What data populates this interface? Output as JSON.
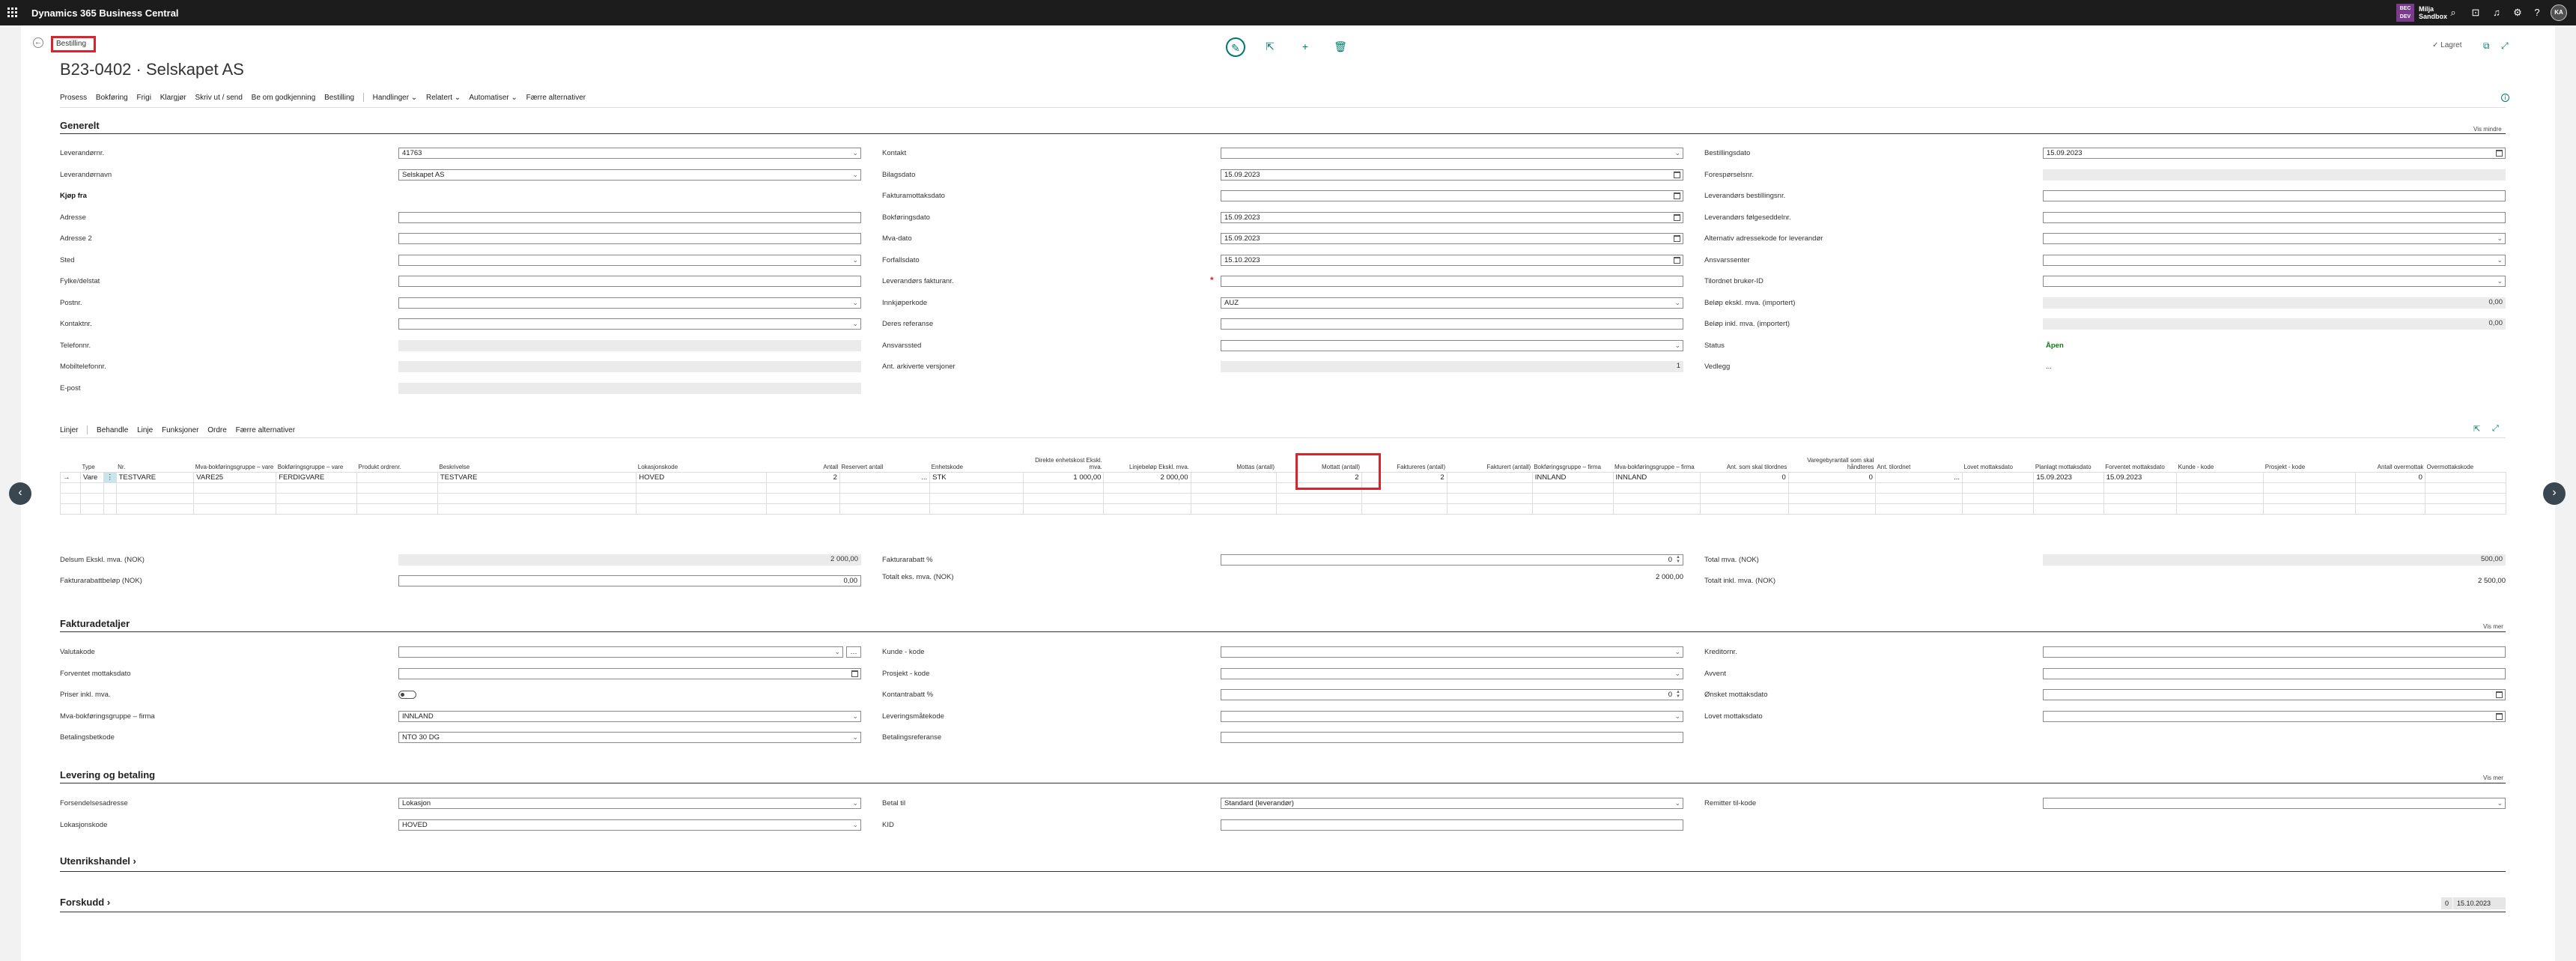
{
  "app": {
    "name": "Dynamics 365 Business Central",
    "company_initials": "BEC\nDEV",
    "company_line1": "Milja",
    "company_line2": "Sandbox",
    "avatar": "KA"
  },
  "header": {
    "breadcrumb": "Bestilling",
    "title": "B23-0402 · Selskapet AS",
    "saved": "✓ Lagret"
  },
  "actions": [
    "Prosess",
    "Bokføring",
    "Frigi",
    "Klargjør",
    "Skriv ut / send",
    "Be om godkjenning",
    "Bestilling"
  ],
  "actions2": [
    "Handlinger ⌄",
    "Relatert ⌄",
    "Automatiser ⌄",
    "Færre alternativer"
  ],
  "general": {
    "heading": "Generelt",
    "show_less": "Vis mindre",
    "col1": [
      {
        "label": "Leverandørnr.",
        "value": "41763",
        "type": "dd"
      },
      {
        "label": "Leverandørnavn",
        "value": "Selskapet AS",
        "type": "dd"
      },
      {
        "label": "Kjøp fra",
        "value": "",
        "type": "heading"
      },
      {
        "label": "Adresse",
        "value": "",
        "type": "text"
      },
      {
        "label": "Adresse 2",
        "value": "",
        "type": "text"
      },
      {
        "label": "Sted",
        "value": "",
        "type": "dd"
      },
      {
        "label": "Fylke/delstat",
        "value": "",
        "type": "text"
      },
      {
        "label": "Postnr.",
        "value": "",
        "type": "dd"
      },
      {
        "label": "Kontaktnr.",
        "value": "",
        "type": "dd"
      },
      {
        "label": "Telefonnr.",
        "value": "",
        "type": "ro"
      },
      {
        "label": "Mobiltelefonnr.",
        "value": "",
        "type": "ro"
      },
      {
        "label": "E-post",
        "value": "",
        "type": "ro"
      }
    ],
    "col2": [
      {
        "label": "Kontakt",
        "value": "",
        "type": "dd"
      },
      {
        "label": "Bilagsdato",
        "value": "15.09.2023",
        "type": "date"
      },
      {
        "label": "Fakturamottaksdato",
        "value": "",
        "type": "date"
      },
      {
        "label": "Bokføringsdato",
        "value": "15.09.2023",
        "type": "date"
      },
      {
        "label": "Mva-dato",
        "value": "15.09.2023",
        "type": "date"
      },
      {
        "label": "Forfallsdato",
        "value": "15.10.2023",
        "type": "date"
      },
      {
        "label": "Leverandørs fakturanr.",
        "value": "",
        "type": "req"
      },
      {
        "label": "Innkjøperkode",
        "value": "AUZ",
        "type": "dd"
      },
      {
        "label": "Deres referanse",
        "value": "",
        "type": "text"
      },
      {
        "label": "Ansvarssted",
        "value": "",
        "type": "dd"
      },
      {
        "label": "Ant. arkiverte versjoner",
        "value": "1",
        "type": "ro-r"
      }
    ],
    "col3": [
      {
        "label": "Bestillingsdato",
        "value": "15.09.2023",
        "type": "date"
      },
      {
        "label": "Forespørselsnr.",
        "value": "",
        "type": "ro"
      },
      {
        "label": "Leverandørs bestillingsnr.",
        "value": "",
        "type": "text"
      },
      {
        "label": "Leverandørs følgeseddelnr.",
        "value": "",
        "type": "text"
      },
      {
        "label": "Alternativ adressekode for leverandør",
        "value": "",
        "type": "dd"
      },
      {
        "label": "Ansvarssenter",
        "value": "",
        "type": "dd"
      },
      {
        "label": "Tilordnet bruker-ID",
        "value": "",
        "type": "dd"
      },
      {
        "label": "Beløp ekskl. mva. (importert)",
        "value": "0,00",
        "type": "ro-r"
      },
      {
        "label": "Beløp inkl. mva. (importert)",
        "value": "0,00",
        "type": "ro-r"
      },
      {
        "label": "Status",
        "value": "Åpen",
        "type": "status"
      },
      {
        "label": "Vedlegg",
        "value": "...",
        "type": "plain"
      }
    ]
  },
  "lines": {
    "tabs": [
      "Linjer",
      "Behandle",
      "Linje",
      "Funksjoner",
      "Ordre",
      "Færre alternativer"
    ],
    "columns": [
      "",
      "Type",
      "",
      "Nr.",
      "Mva-bokføringsgruppe – vare",
      "Bokføringsgruppe – vare",
      "Produkt ordrenr.",
      "Beskrivelse",
      "Lokasjonskode",
      "Antall",
      "Reservert antall",
      "Enhetskode",
      "Direkte enhetskost Ekskl. mva.",
      "Linjebeløp Ekskl. mva.",
      "Mottas (antall)",
      "Mottatt (antall)",
      "Faktureres (antall)",
      "Fakturert (antall)",
      "Bokføringsgruppe – firma",
      "Mva-bokføringsgruppe – firma",
      "Ant. som skal tilordnes",
      "Varegebyrantall som skal håndteres",
      "Ant. tilordnet",
      "Lovet mottaksdato",
      "Planlagt mottaksdato",
      "Forventet mottaksdato",
      "Kunde - kode",
      "Prosjekt - kode",
      "Antall overmottak",
      "Overmottakskode"
    ],
    "row": [
      "→",
      "Vare",
      "⋮",
      "TESTVARE",
      "VARE25",
      "FERDIGVARE",
      "",
      "TESTVARE",
      "HOVED",
      "2",
      "...",
      "STK",
      "1 000,00",
      "2 000,00",
      "",
      "2",
      "2",
      "",
      "INNLAND",
      "INNLAND",
      "0",
      "0",
      "...",
      "",
      "15.09.2023",
      "15.09.2023",
      "",
      "",
      "0",
      ""
    ]
  },
  "totals": {
    "col1": [
      {
        "label": "Delsum Ekskl. mva. (NOK)",
        "value": "2 000,00",
        "type": "ro-r"
      },
      {
        "label": "Fakturarabattbeløp (NOK)",
        "value": "0,00",
        "type": "text-r"
      }
    ],
    "col2": [
      {
        "label": "Fakturarabatt %",
        "value": "0",
        "type": "spin"
      },
      {
        "label": "Totalt eks. mva. (NOK)",
        "value": "2 000,00",
        "type": "plain-r"
      }
    ],
    "col3": [
      {
        "label": "Total mva. (NOK)",
        "value": "500,00",
        "type": "ro-r"
      },
      {
        "label": "Totalt inkl. mva. (NOK)",
        "value": "2 500,00",
        "type": "plain-r"
      }
    ]
  },
  "invoice": {
    "heading": "Fakturadetaljer",
    "show_more": "Vis mer",
    "col1": [
      {
        "label": "Valutakode",
        "value": "",
        "type": "dd-btn"
      },
      {
        "label": "Forventet mottaksdato",
        "value": "",
        "type": "date"
      },
      {
        "label": "Priser inkl. mva.",
        "value": "",
        "type": "toggle"
      },
      {
        "label": "Mva-bokføringsgruppe – firma",
        "value": "INNLAND",
        "type": "dd"
      },
      {
        "label": "Betalingsbetkode",
        "value": "NTO 30 DG",
        "type": "dd"
      }
    ],
    "col2": [
      {
        "label": "Kunde - kode",
        "value": "",
        "type": "dd"
      },
      {
        "label": "Prosjekt - kode",
        "value": "",
        "type": "dd"
      },
      {
        "label": "Kontantrabatt %",
        "value": "0",
        "type": "spin"
      },
      {
        "label": "Leveringsmåtekode",
        "value": "",
        "type": "dd"
      },
      {
        "label": "Betalingsreferanse",
        "value": "",
        "type": "text"
      }
    ],
    "col3": [
      {
        "label": "Kreditornr.",
        "value": "",
        "type": "text"
      },
      {
        "label": "Avvent",
        "value": "",
        "type": "text"
      },
      {
        "label": "Ønsket mottaksdato",
        "value": "",
        "type": "date"
      },
      {
        "label": "Lovet mottaksdato",
        "value": "",
        "type": "date"
      }
    ]
  },
  "shipping": {
    "heading": "Levering og betaling",
    "show_more": "Vis mer",
    "col1": [
      {
        "label": "Forsendelsesadresse",
        "value": "Lokasjon",
        "type": "dd"
      },
      {
        "label": "Lokasjonskode",
        "value": "HOVED",
        "type": "dd"
      }
    ],
    "col2": [
      {
        "label": "Betal til",
        "value": "Standard (leverandør)",
        "type": "dd"
      },
      {
        "label": "KID",
        "value": "",
        "type": "text"
      }
    ],
    "col3": [
      {
        "label": "Remitter til-kode",
        "value": "",
        "type": "dd"
      }
    ]
  },
  "foreign": {
    "heading": "Utenrikshandel ›"
  },
  "prepayment": {
    "heading": "Forskudd ›",
    "pill1": "0",
    "pill2": "15.10.2023"
  }
}
